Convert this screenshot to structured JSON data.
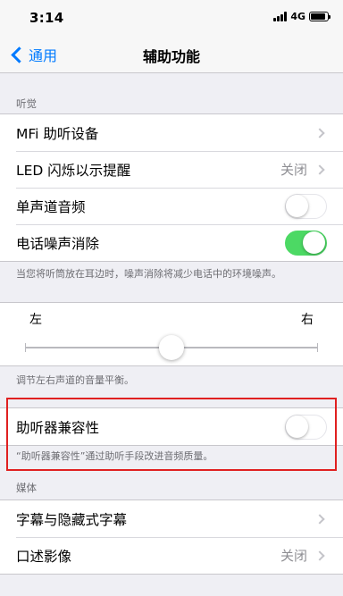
{
  "status_bar": {
    "time": "3:14",
    "network": "4G",
    "battery_level": 0.9
  },
  "nav": {
    "back_label": "通用",
    "title": "辅助功能"
  },
  "hearing": {
    "header": "听觉",
    "rows": [
      {
        "label": "MFi 助听设备",
        "value": ""
      },
      {
        "label": "LED 闪烁以示提醒",
        "value": "关闭"
      },
      {
        "label": "单声道音频",
        "switch": false
      },
      {
        "label": "电话噪声消除",
        "switch": true
      }
    ],
    "footer": "当您将听筒放在耳边时，噪声消除将减少电话中的环境噪声。"
  },
  "balance": {
    "left_label": "左",
    "right_label": "右",
    "position": 0.5,
    "footer": "调节左右声道的音量平衡。"
  },
  "hearing_aid": {
    "label": "助听器兼容性",
    "switch": false,
    "footer": "“助听器兼容性”通过助听手段改进音频质量。"
  },
  "media": {
    "header": "媒体",
    "rows": [
      {
        "label": "字幕与隐藏式字幕",
        "value": ""
      },
      {
        "label": "口述影像",
        "value": "关闭"
      }
    ]
  },
  "colors": {
    "accent": "#007aff",
    "switch_on": "#4cd964",
    "highlight": "#e02020"
  }
}
